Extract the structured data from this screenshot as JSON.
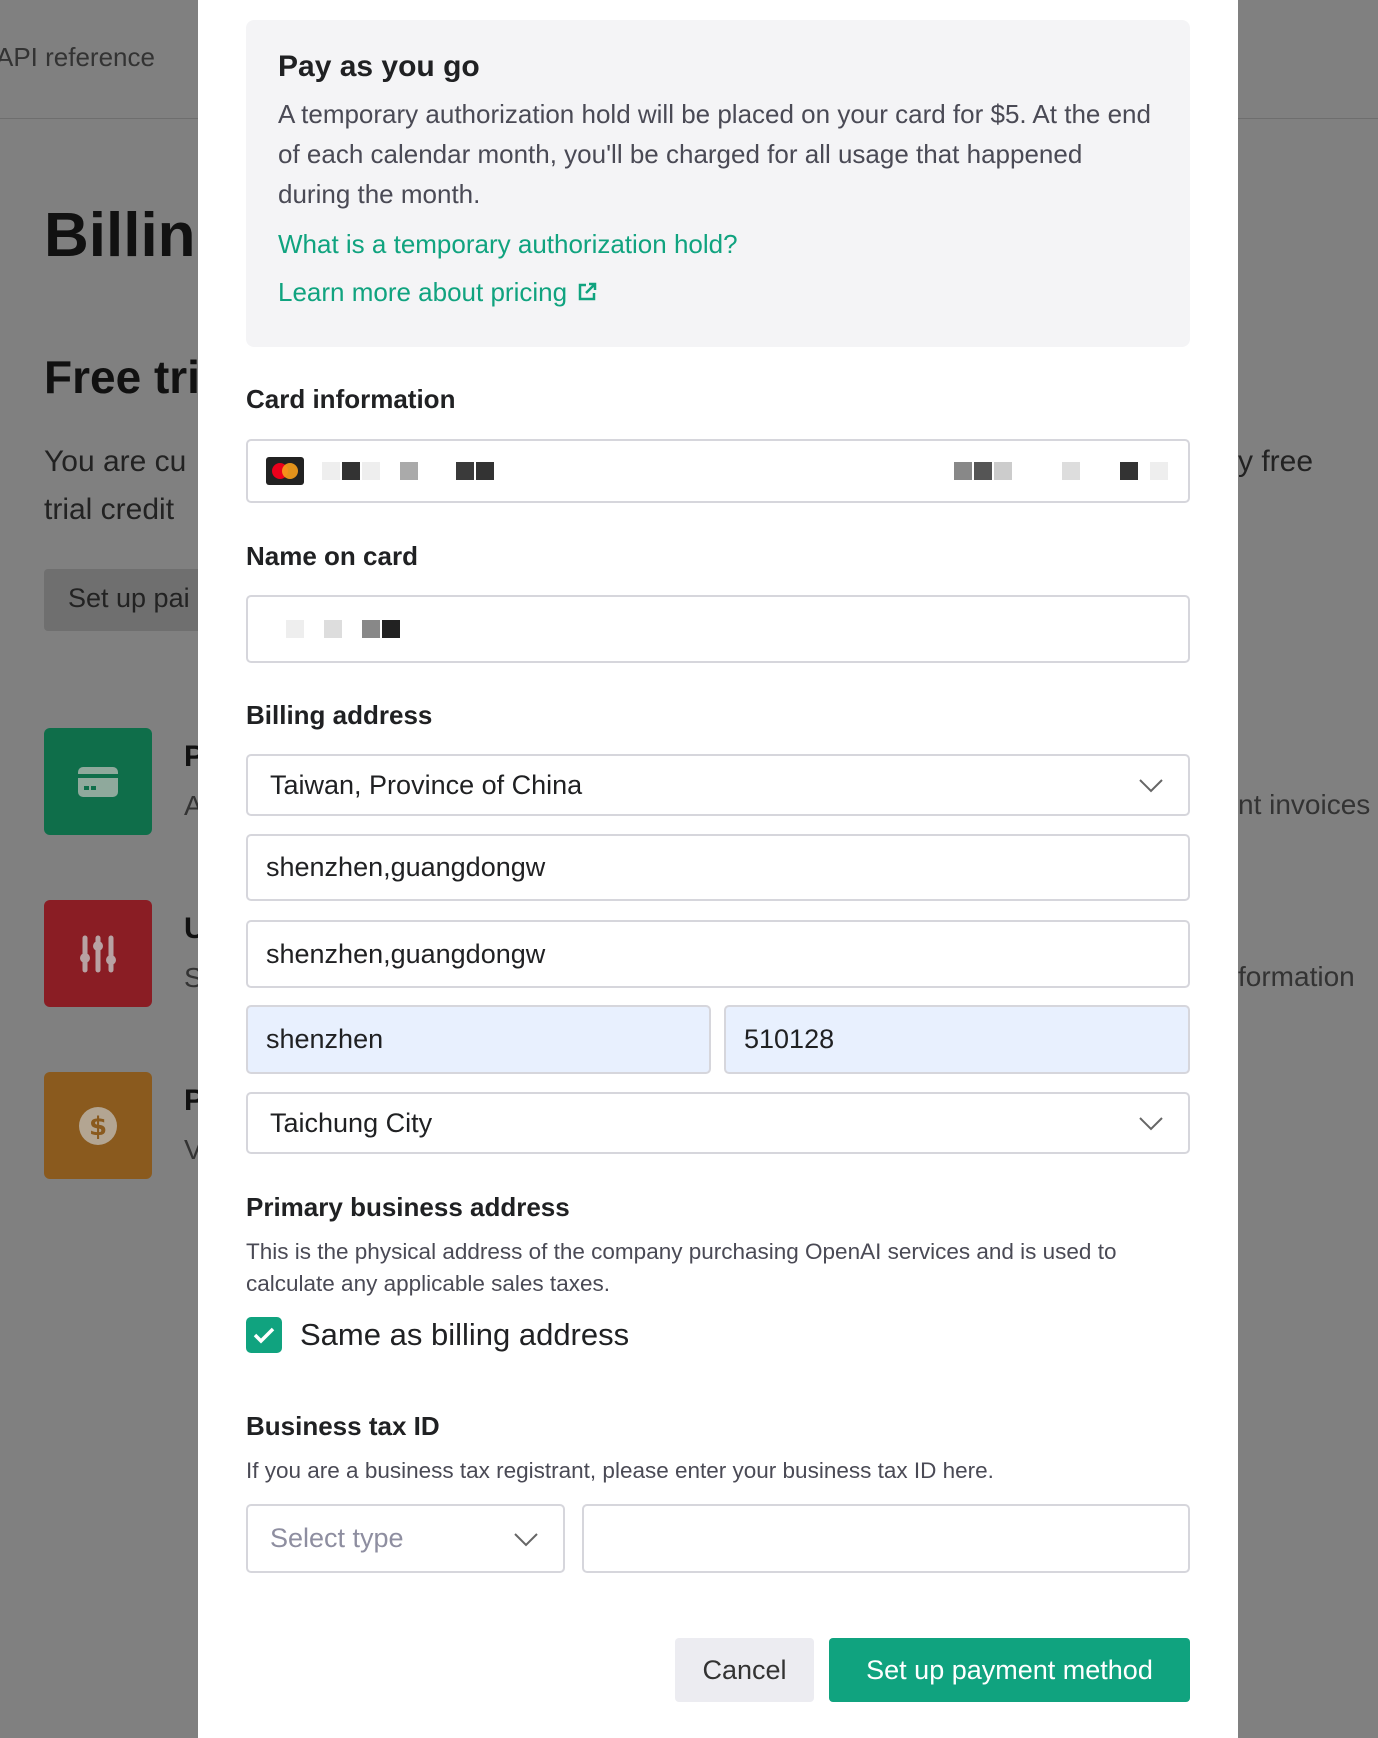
{
  "background": {
    "nav_link": "API reference",
    "page_title_partial": "Billin",
    "section_title_partial": "Free tri",
    "text_line1_partial": "You are cu",
    "text_line2_partial": "trial credit",
    "right_text1_partial": "y free",
    "right_text2_partial": "nt invoices",
    "right_text3_partial": "formation",
    "button_partial": "Set up pai",
    "tiles": [
      {
        "icon": "credit-card-icon",
        "color": "#0f6e4a",
        "title_partial": "P",
        "sub_partial": "A"
      },
      {
        "icon": "sliders-icon",
        "color": "#8a1d24",
        "title_partial": "U",
        "sub_partial": "S"
      },
      {
        "icon": "dollar-icon",
        "color": "#8a5a1e",
        "title_partial": "P",
        "sub_partial": "V"
      }
    ]
  },
  "modal": {
    "info": {
      "title": "Pay as you go",
      "body": "A temporary authorization hold will be placed on your card for $5. At the end of each calendar month, you'll be charged for all usage that happened during the month.",
      "link_hold": "What is a temporary authorization hold?",
      "link_pricing": "Learn more about pricing"
    },
    "card_label": "Card information",
    "name_label": "Name on card",
    "billing_label": "Billing address",
    "country": "Taiwan, Province of China",
    "address_line1": "shenzhen,guangdongw",
    "address_line2": "shenzhen,guangdongw",
    "city": "shenzhen",
    "postal_code": "510128",
    "state": "Taichung City",
    "primary_label": "Primary business address",
    "primary_desc": "This is the physical address of the company purchasing OpenAI services and is used to calculate any applicable sales taxes.",
    "same_as_billing": "Same as billing address",
    "same_as_billing_checked": true,
    "tax_label": "Business tax ID",
    "tax_desc": "If you are a business tax registrant, please enter your business tax ID here.",
    "tax_type_placeholder": "Select type",
    "tax_id_value": "",
    "cancel": "Cancel",
    "submit": "Set up payment method",
    "accent": "#10a37f"
  }
}
